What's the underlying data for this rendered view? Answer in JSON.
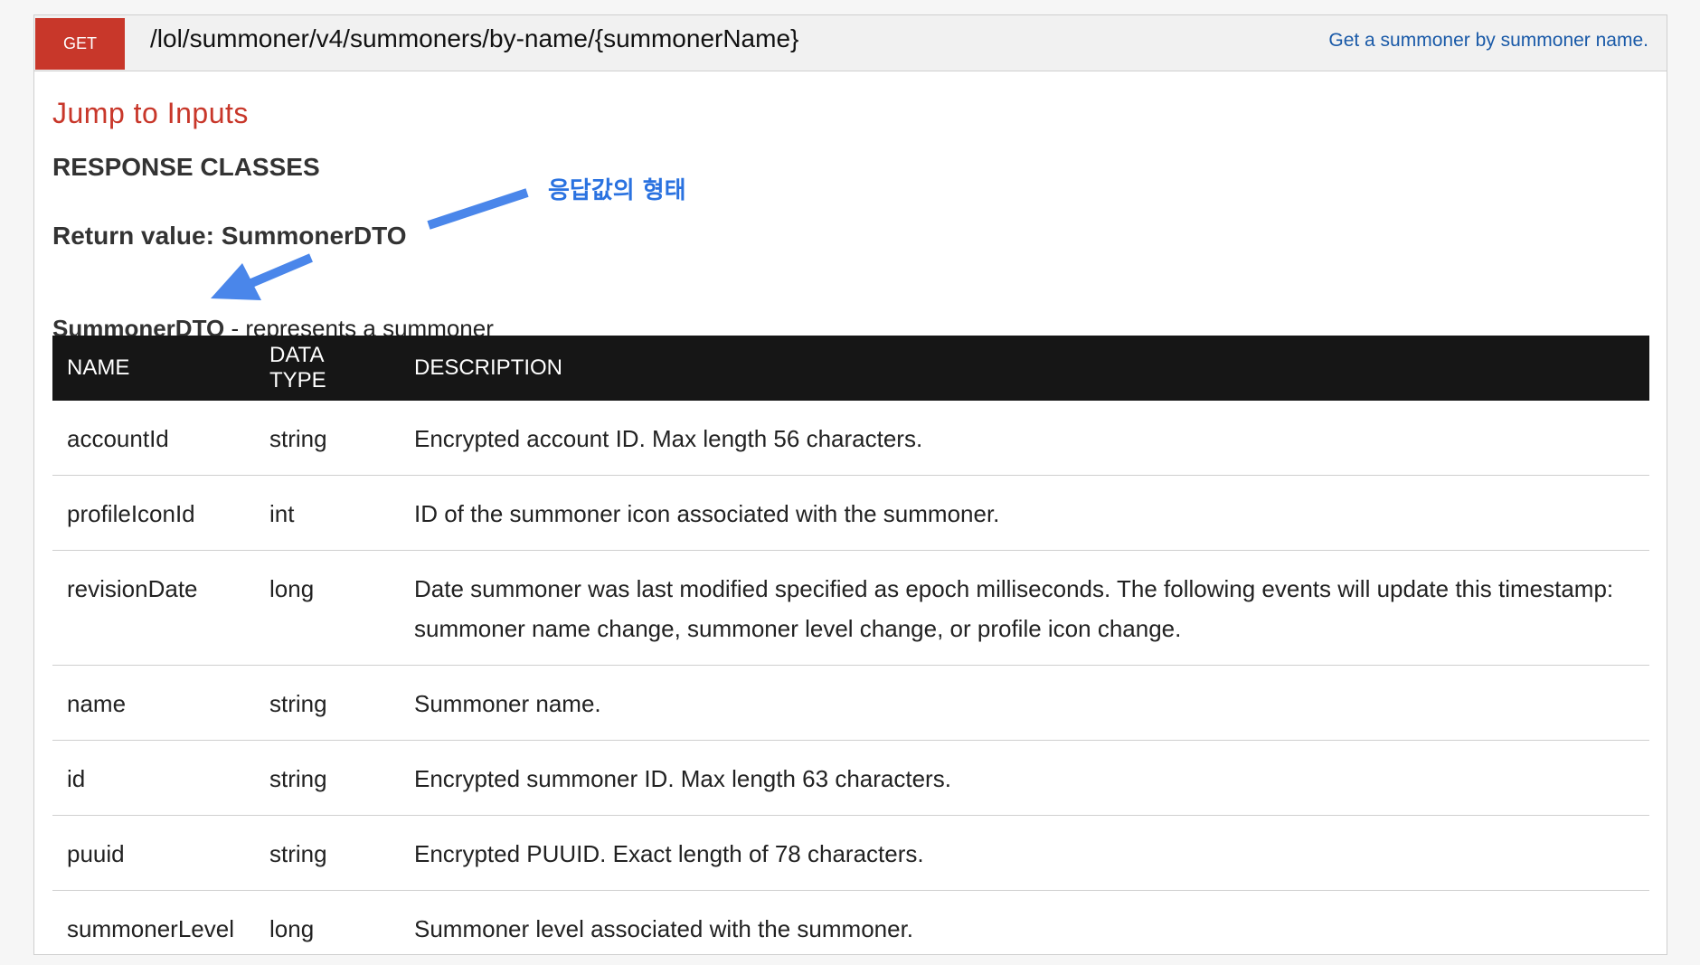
{
  "endpoint": {
    "method": "GET",
    "path": "/lol/summoner/v4/summoners/by-name/{summonerName}",
    "summary": "Get a summoner by summoner name."
  },
  "jump_link": "Jump to Inputs",
  "response": {
    "heading": "RESPONSE CLASSES",
    "return_label": "Return value: SummonerDTO",
    "annotation": "응답값의 형태",
    "annotation_color": "#2a72e0",
    "dto_name": "SummonerDTO",
    "dto_description": " - represents a summoner"
  },
  "table": {
    "headers": [
      "NAME",
      "DATA TYPE",
      "DESCRIPTION"
    ],
    "rows": [
      {
        "name": "accountId",
        "type": "string",
        "description": "Encrypted account ID. Max length 56 characters."
      },
      {
        "name": "profileIconId",
        "type": "int",
        "description": "ID of the summoner icon associated with the summoner."
      },
      {
        "name": "revisionDate",
        "type": "long",
        "description": "Date summoner was last modified specified as epoch milliseconds. The following events will update this timestamp: summoner name change, summoner level change, or profile icon change."
      },
      {
        "name": "name",
        "type": "string",
        "description": "Summoner name."
      },
      {
        "name": "id",
        "type": "string",
        "description": "Encrypted summoner ID. Max length 63 characters."
      },
      {
        "name": "puuid",
        "type": "string",
        "description": "Encrypted PUUID. Exact length of 78 characters."
      },
      {
        "name": "summonerLevel",
        "type": "long",
        "description": "Summoner level associated with the summoner."
      }
    ]
  },
  "colors": {
    "method_badge": "#c8372a",
    "link_blue": "#1a5aa8",
    "jump_red": "#c8372a",
    "table_header": "#161616"
  }
}
